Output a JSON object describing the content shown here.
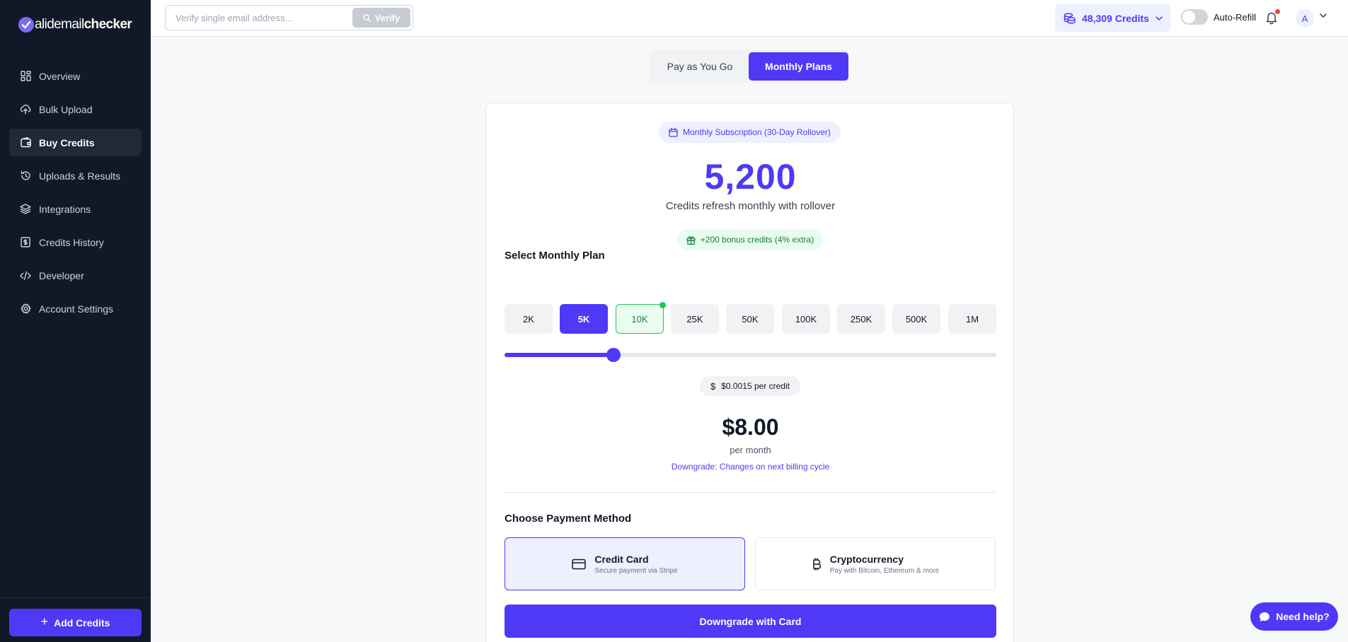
{
  "brand": {
    "prefix": "alidemail",
    "suffix": "checker",
    "accent": "#4f39f6"
  },
  "sidebar": {
    "items": [
      {
        "label": "Overview",
        "icon": "grid-icon"
      },
      {
        "label": "Bulk Upload",
        "icon": "cloud-upload-icon"
      },
      {
        "label": "Buy Credits",
        "icon": "wallet-icon",
        "active": true
      },
      {
        "label": "Uploads & Results",
        "icon": "history-icon"
      },
      {
        "label": "Integrations",
        "icon": "layers-icon"
      },
      {
        "label": "Credits History",
        "icon": "receipt-icon"
      },
      {
        "label": "Developer",
        "icon": "code-icon"
      },
      {
        "label": "Account Settings",
        "icon": "gear-icon"
      }
    ],
    "add_credits_label": "Add Credits"
  },
  "topbar": {
    "verify_placeholder": "Verify single email address...",
    "verify_label": "Verify",
    "credits_label": "48,309 Credits",
    "auto_refill_label": "Auto-Refill",
    "auto_refill_on": false,
    "avatar_initial": "A"
  },
  "mode_tabs": {
    "pay_as_you_go": "Pay as You Go",
    "monthly_plans": "Monthly Plans",
    "selected": "monthly_plans"
  },
  "plan_card": {
    "subscription_badge": "Monthly Subscription (30-Day Rollover)",
    "credits_amount": "5,200",
    "credits_subtitle": "Credits refresh monthly with rollover",
    "bonus_label": "+200 bonus credits (4% extra)",
    "select_plan_title": "Select Monthly Plan",
    "plans": [
      {
        "label": "2K"
      },
      {
        "label": "5K",
        "state": "selected"
      },
      {
        "label": "10K",
        "state": "current"
      },
      {
        "label": "25K"
      },
      {
        "label": "50K"
      },
      {
        "label": "100K"
      },
      {
        "label": "250K"
      },
      {
        "label": "500K"
      },
      {
        "label": "1M"
      }
    ],
    "slider_fraction": 0.222,
    "per_credit_label": "$0.0015 per credit",
    "price": "$8.00",
    "price_period": "per month",
    "downgrade_note": "Downgrade: Changes on next billing cycle",
    "payment_title": "Choose Payment Method",
    "payment_options": [
      {
        "title": "Credit Card",
        "subtitle": "Secure payment via Stripe",
        "icon": "credit-card-icon",
        "selected": true
      },
      {
        "title": "Cryptocurrency",
        "subtitle": "Pay with Bitcoin, Ethereum & more",
        "icon": "bitcoin-icon",
        "selected": false
      }
    ],
    "submit_label": "Downgrade with Card"
  },
  "help_label": "Need help?"
}
